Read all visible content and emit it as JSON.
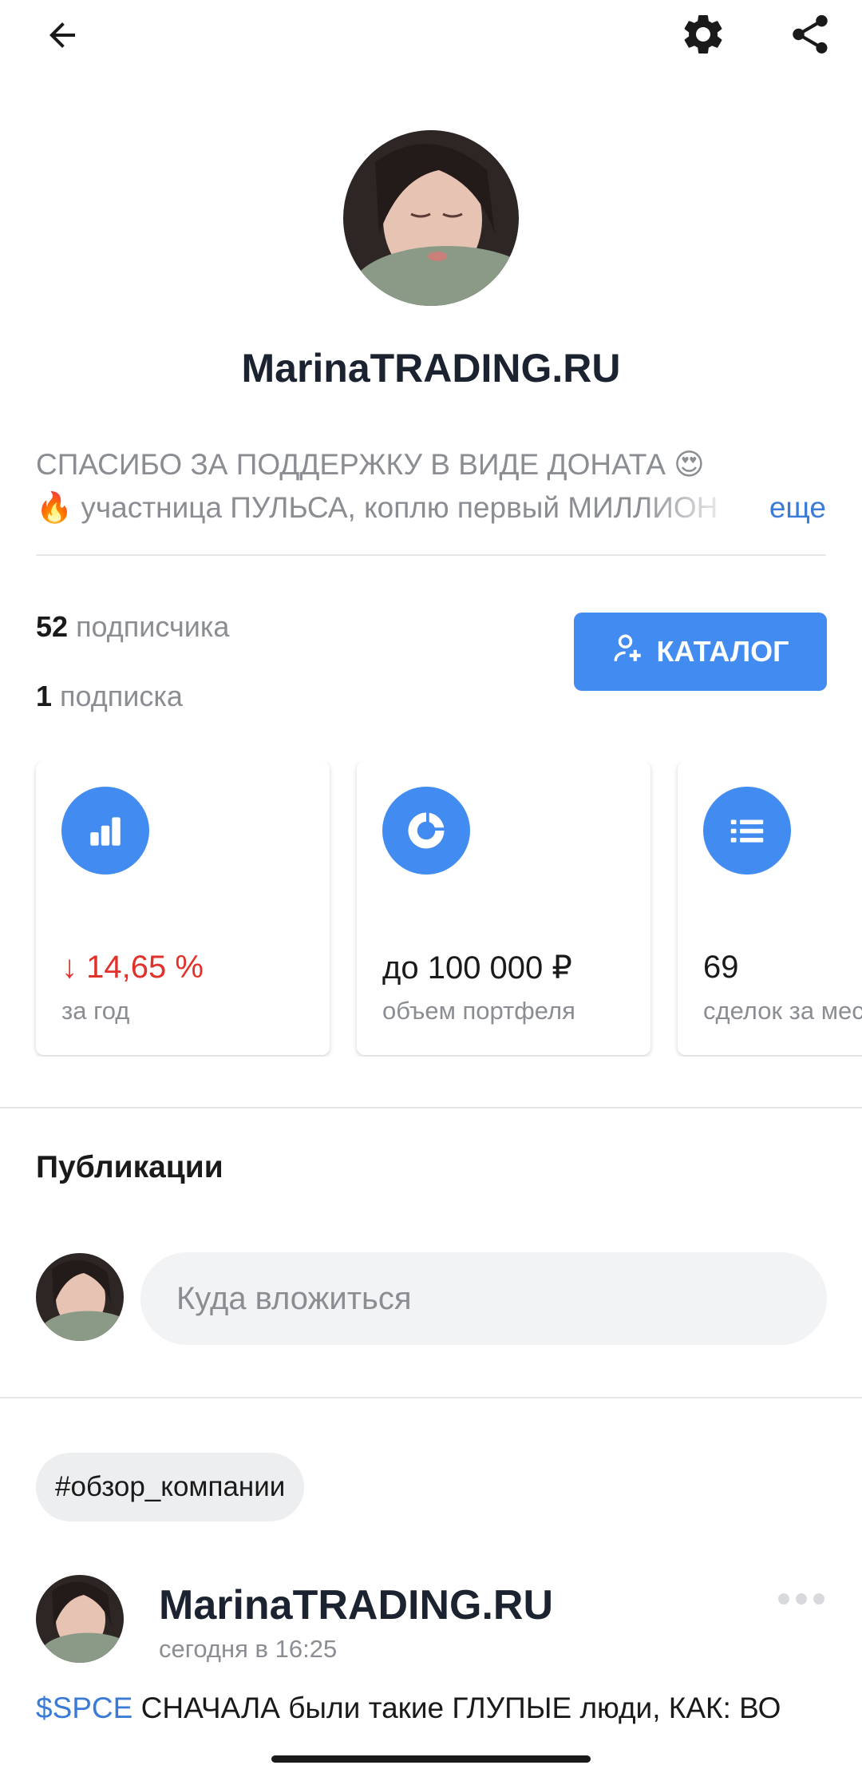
{
  "header": {
    "back_icon": "arrow-left-icon",
    "settings_icon": "gear-icon",
    "share_icon": "share-icon"
  },
  "profile": {
    "name": "MarinaTRADING.RU",
    "bio_line1": "СПАСИБО ЗА ПОДДЕРЖКУ В ВИДЕ ДОНАТА 😍",
    "bio_line2": "🔥 участница ПУЛЬСА, коплю первый МИЛЛИОН",
    "bio_more": "еще",
    "followers_count": "52",
    "followers_label": "подписчика",
    "following_count": "1",
    "following_label": "подписка",
    "catalog_button": "КАТАЛОГ"
  },
  "cards": [
    {
      "icon": "bar-chart-icon",
      "value": "14,65 %",
      "label": "за год",
      "trend": "down",
      "color": "#e0312a"
    },
    {
      "icon": "portfolio-icon",
      "value": "до 100 000 ₽",
      "label": "объем портфеля"
    },
    {
      "icon": "list-icon",
      "value": "69",
      "label": "сделок за месяц"
    }
  ],
  "publications": {
    "title": "Публикации",
    "composer_placeholder": "Куда вложиться"
  },
  "post": {
    "tag": "#обзор_компании",
    "author": "MarinaTRADING.RU",
    "time": "сегодня в 16:25",
    "ticker": "$SPCE",
    "text": " СНАЧАЛА были такие ГЛУПЫЕ люди, КАК:  ВО"
  },
  "colors": {
    "accent": "#428bf0",
    "negative": "#e0312a",
    "link": "#3b7bd8"
  }
}
